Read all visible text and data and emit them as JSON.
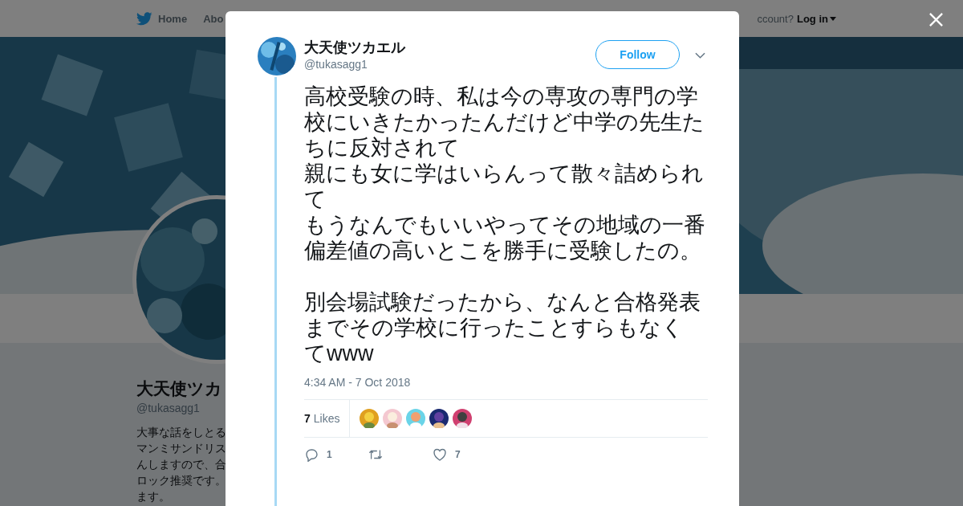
{
  "top_nav": {
    "items": [
      {
        "kind": "home",
        "label": "Home"
      },
      {
        "kind": "plain",
        "label": "Abo"
      }
    ],
    "account_text": "ccount?",
    "login": "Log in"
  },
  "profile": {
    "name": "大天使ツカ",
    "handle": "@tukasagg1",
    "bio_lines": [
      "大事な話をしとる",
      "マンミサンドリス",
      "んしますので、合",
      "ロック推奨です。",
      "ます。"
    ]
  },
  "tweet": {
    "author": "大天使ツカエル",
    "handle": "@tukasagg1",
    "follow": "Follow",
    "paragraphs": [
      [
        "高校受験の時、私は今の専攻の専門の学校にいきたかったんだけど中学の先生たちに反対されて",
        "親にも女に学はいらんって散々詰められて",
        "もうなんでもいいやってその地域の一番偏差値の高いとこを勝手に受験したの。"
      ],
      [
        "別会場試験だったから、なんと合格発表までその学校に行ったことすらもなくてwww"
      ]
    ],
    "timestamp": "4:34 AM - 7 Oct 2018",
    "likes_count": "7",
    "likes_label": "Likes",
    "likers": [
      {
        "kind": "picture"
      },
      {
        "kind": "picture"
      },
      {
        "kind": "picture"
      },
      {
        "kind": "picture"
      },
      {
        "kind": "picture"
      }
    ],
    "actions": [
      {
        "kind": "reply",
        "count": "1"
      },
      {
        "kind": "retweet"
      },
      {
        "kind": "like",
        "count": "7"
      }
    ]
  }
}
